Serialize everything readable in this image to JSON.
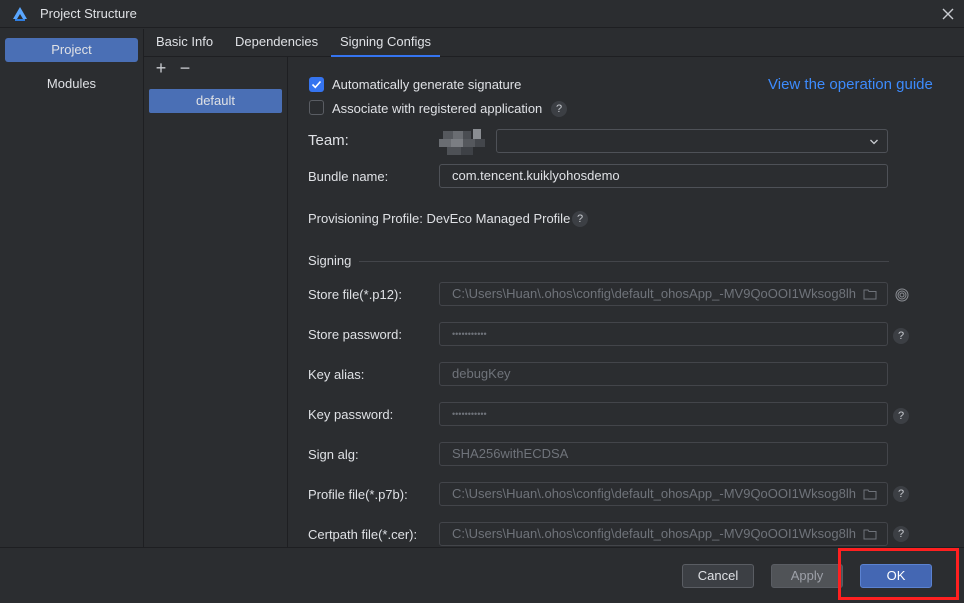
{
  "window": {
    "title": "Project Structure",
    "icons": {
      "logo": "app-logo-icon",
      "close": "close-icon"
    }
  },
  "left_nav": {
    "items": [
      {
        "label": "Project",
        "selected": true
      },
      {
        "label": "Modules",
        "selected": false
      }
    ]
  },
  "tabs": [
    {
      "label": "Basic Info",
      "active": false
    },
    {
      "label": "Dependencies",
      "active": false
    },
    {
      "label": "Signing Configs",
      "active": true
    }
  ],
  "config_list": {
    "add_icon": "+",
    "remove_icon": "−",
    "items": [
      "default"
    ]
  },
  "signing": {
    "auto_generate": {
      "label": "Automatically generate signature",
      "checked": true
    },
    "associate": {
      "label": "Associate with registered application",
      "checked": false
    },
    "guide_link": "View the operation guide",
    "team": {
      "label": "Team:",
      "value": ""
    },
    "bundle_name": {
      "label": "Bundle name:",
      "value": "com.tencent.kuiklyohosdemo"
    },
    "provisioning_profile": "Provisioning Profile: DevEco Managed Profile",
    "section_title": "Signing",
    "store_file": {
      "label": "Store file(*.p12):",
      "value": "C:\\Users\\Huan\\.ohos\\config\\default_ohosApp_-MV9QoOOI1Wksog8lh"
    },
    "store_password": {
      "label": "Store password:",
      "value": "•••••••••••"
    },
    "key_alias": {
      "label": "Key alias:",
      "value": "debugKey"
    },
    "key_password": {
      "label": "Key password:",
      "value": "•••••••••••"
    },
    "sign_alg": {
      "label": "Sign alg:",
      "value": "SHA256withECDSA"
    },
    "profile_file": {
      "label": "Profile file(*.p7b):",
      "value": "C:\\Users\\Huan\\.ohos\\config\\default_ohosApp_-MV9QoOOI1Wksog8lh"
    },
    "certpath_file": {
      "label": "Certpath file(*.cer):",
      "value": "C:\\Users\\Huan\\.ohos\\config\\default_ohosApp_-MV9QoOOI1Wksog8lh"
    },
    "help_glyph": "?"
  },
  "footer": {
    "cancel": "Cancel",
    "apply": "Apply",
    "ok": "OK",
    "highlight_color": "#ff2020"
  },
  "colors": {
    "background": "#2b2d30",
    "accent": "#3574f0",
    "selection": "#4a6fb5",
    "link": "#3d8bfd"
  }
}
